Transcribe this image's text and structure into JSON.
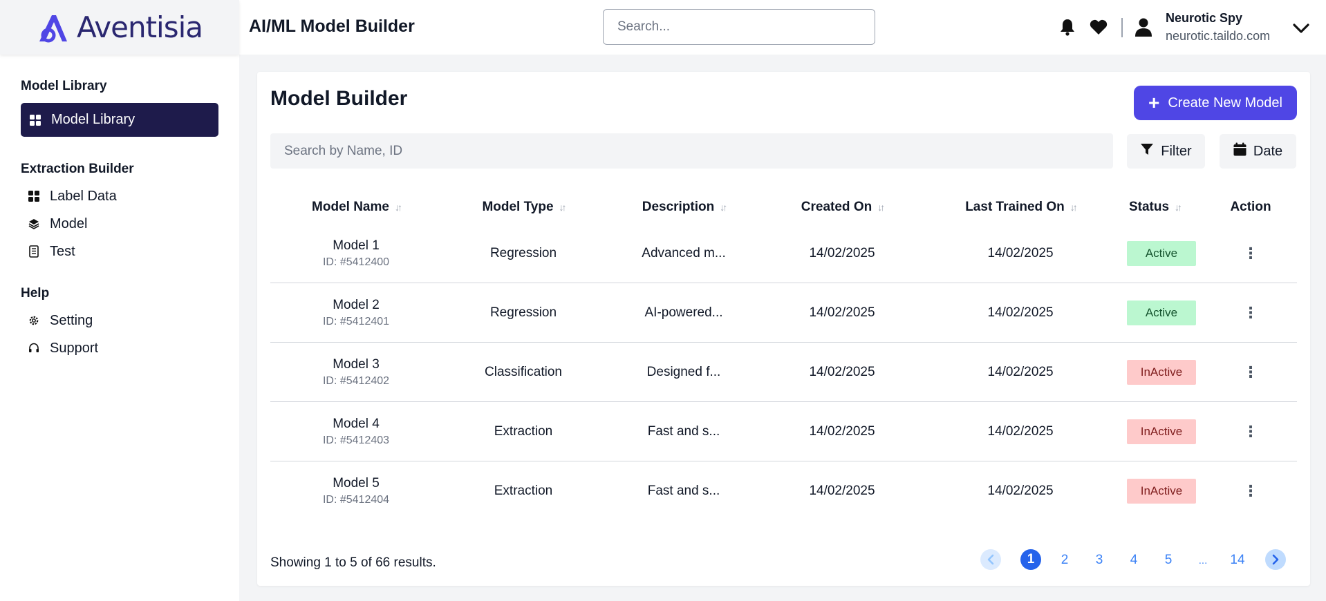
{
  "brand": {
    "name": "Aventisia"
  },
  "header": {
    "title": "AI/ML Model Builder",
    "search_placeholder": "Search...",
    "user": {
      "name": "Neurotic Spy",
      "email": "neurotic.taildo.com"
    }
  },
  "sidebar": {
    "sections": [
      {
        "heading": "Model Library",
        "items": [
          {
            "label": "Model Library",
            "icon": "grid-icon",
            "active": true
          }
        ]
      },
      {
        "heading": "Extraction Builder",
        "items": [
          {
            "label": "Label Data",
            "icon": "grid-icon"
          },
          {
            "label": "Model",
            "icon": "layers-icon"
          },
          {
            "label": "Test",
            "icon": "document-icon"
          }
        ]
      },
      {
        "heading": "Help",
        "items": [
          {
            "label": "Setting",
            "icon": "gear-icon"
          },
          {
            "label": "Support",
            "icon": "headset-icon"
          }
        ]
      }
    ]
  },
  "main": {
    "title": "Model Builder",
    "create_label": "Create New Model",
    "search_placeholder": "Search by Name, ID",
    "filter_label": "Filter",
    "date_label": "Date",
    "columns": [
      "Model Name",
      "Model Type",
      "Description",
      "Created On",
      "Last Trained On",
      "Status",
      "Action"
    ],
    "rows": [
      {
        "name": "Model 1",
        "id": "ID: #5412400",
        "type": "Regression",
        "description": "Advanced m...",
        "created": "14/02/2025",
        "trained": "14/02/2025",
        "status": "Active"
      },
      {
        "name": "Model 2",
        "id": "ID: #5412401",
        "type": "Regression",
        "description": "AI-powered...",
        "created": "14/02/2025",
        "trained": "14/02/2025",
        "status": "Active"
      },
      {
        "name": "Model 3",
        "id": "ID: #5412402",
        "type": "Classification",
        "description": "Designed f...",
        "created": "14/02/2025",
        "trained": "14/02/2025",
        "status": "InActive"
      },
      {
        "name": "Model 4",
        "id": "ID: #5412403",
        "type": "Extraction",
        "description": "Fast and s...",
        "created": "14/02/2025",
        "trained": "14/02/2025",
        "status": "InActive"
      },
      {
        "name": "Model 5",
        "id": "ID: #5412404",
        "type": "Extraction",
        "description": "Fast and s...",
        "created": "14/02/2025",
        "trained": "14/02/2025",
        "status": "InActive"
      }
    ],
    "showing_text": "Showing 1 to 5 of 66 results.",
    "pagination": {
      "pages": [
        "1",
        "2",
        "3",
        "4",
        "5",
        "...",
        "14"
      ],
      "current": "1"
    }
  },
  "colors": {
    "accent": "#4f46e5",
    "sidebar_active": "#1e1b4b",
    "active_badge": "#bbf7d0",
    "inactive_badge": "#fecaca",
    "pager_blue": "#2563eb"
  }
}
